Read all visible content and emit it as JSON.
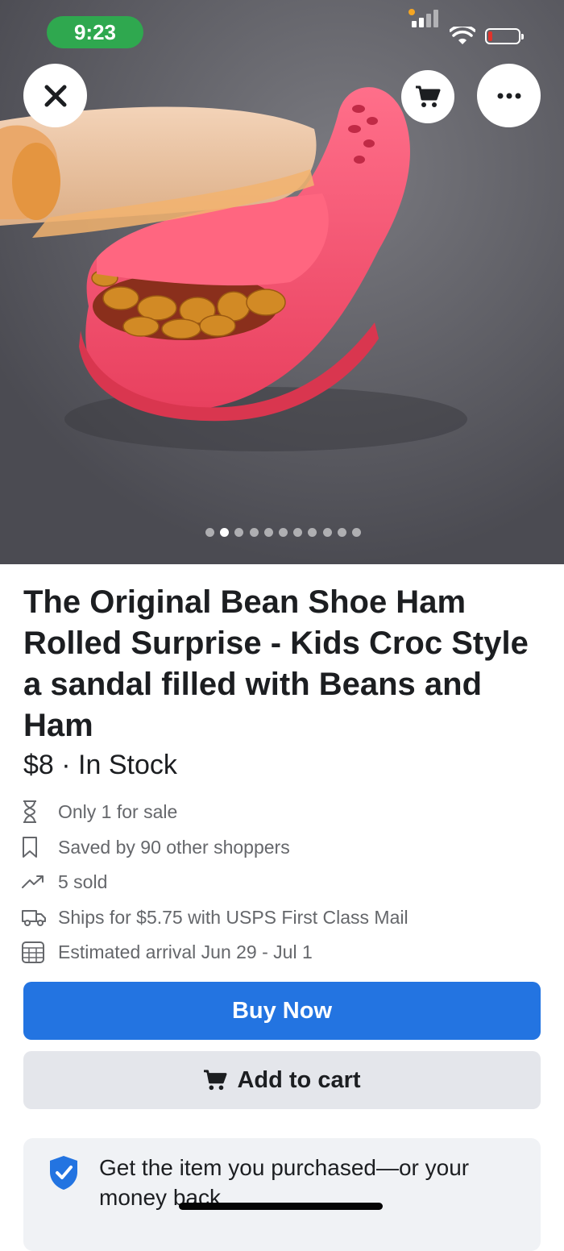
{
  "status_bar": {
    "time": "9:23"
  },
  "gallery": {
    "image_alt": "Pink croc-style sandal filled with beans with a rolled slice of ham",
    "page_count": 11,
    "active_index": 1
  },
  "toolbar": {
    "close_icon": "close-icon",
    "cart_icon": "cart-icon",
    "more_icon": "more-icon"
  },
  "listing": {
    "title": "The Original Bean Shoe Ham Rolled Surprise - Kids Croc Style a sandal filled with Beans and Ham",
    "price_stock": "$8 · In Stock"
  },
  "details": [
    {
      "icon": "hourglass-icon",
      "text": "Only 1 for sale"
    },
    {
      "icon": "bookmark-icon",
      "text": "Saved by 90 other shoppers"
    },
    {
      "icon": "trending-icon",
      "text": "5 sold"
    },
    {
      "icon": "truck-icon",
      "text": "Ships for $5.75 with USPS First Class Mail"
    },
    {
      "icon": "calendar-icon",
      "text": "Estimated arrival Jun 29 - Jul 1"
    }
  ],
  "actions": {
    "buy_now": "Buy Now",
    "add_to_cart": "Add to cart"
  },
  "protection": {
    "text": "Get the item you purchased—or your money back"
  },
  "colors": {
    "primary_button": "#2374e1",
    "secondary_button": "#e4e6eb",
    "status_pill": "#2fa84f",
    "shoe": "#f0506e"
  }
}
